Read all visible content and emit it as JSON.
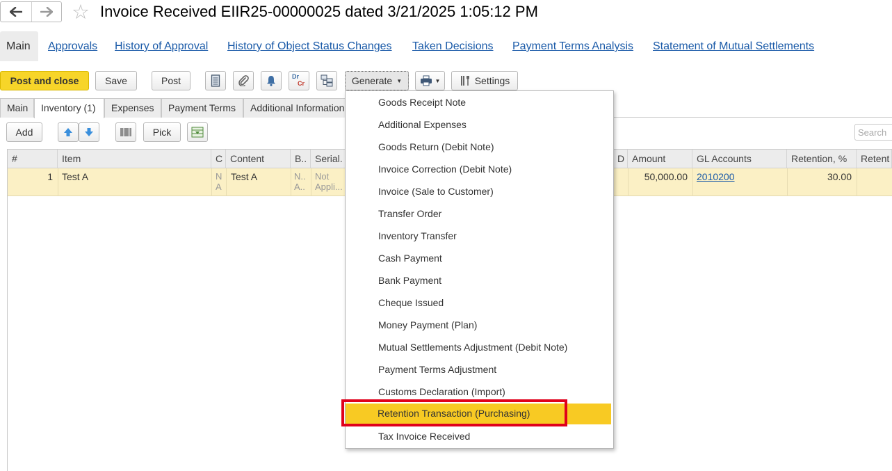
{
  "window": {
    "title": "Invoice Received EIIR25-00000025 dated 3/21/2025 1:05:12 PM",
    "back_icon": "arrow-left-icon",
    "forward_icon": "arrow-right-icon",
    "favorite_icon": "star-icon"
  },
  "sections": {
    "main": "Main",
    "links": [
      "Approvals",
      "History of Approval",
      "History of Object Status Changes",
      "Taken Decisions",
      "Payment Terms Analysis",
      "Statement of Mutual Settlements"
    ]
  },
  "toolbar": {
    "post_close": "Post and close",
    "save": "Save",
    "post": "Post",
    "generate": "Generate",
    "settings": "Settings",
    "drcr_top": "Dr",
    "drcr_bottom": "Cr",
    "accent": "#f7d529"
  },
  "tabs": [
    "Main",
    "Inventory (1)",
    "Expenses",
    "Payment Terms",
    "Additional Information"
  ],
  "table_toolbar": {
    "add": "Add",
    "pick": "Pick",
    "search_placeholder": "Search"
  },
  "grid": {
    "columns": [
      "#",
      "Item",
      "C",
      "Content",
      "B..",
      "Serial.",
      "D",
      "Amount",
      "GL Accounts",
      "Retention, %",
      "Retent"
    ],
    "row": {
      "num": "1",
      "item": "Test A",
      "c_line1": "N",
      "c_line2": "A",
      "content": "Test A",
      "b_line1": "N..",
      "b_line2": "A..",
      "serial_line1": "Not",
      "serial_line2": "Appli...",
      "amount": "50,000.00",
      "gl_account": "2010200",
      "retention": "30.00"
    }
  },
  "generate_menu": {
    "items": [
      "Goods Receipt Note",
      "Additional Expenses",
      "Goods Return (Debit Note)",
      "Invoice Correction (Debit Note)",
      "Invoice (Sale to Customer)",
      "Transfer Order",
      "Inventory Transfer",
      "Cash Payment",
      "Bank Payment",
      "Cheque Issued",
      "Money Payment (Plan)",
      "Mutual Settlements Adjustment (Debit Note)",
      "Payment Terms Adjustment",
      "Customs Declaration (Import)",
      "Retention Transaction (Purchasing)",
      "Tax Invoice Received"
    ],
    "highlighted_index": 14,
    "highlight_color": "#f8ca23",
    "annotation_color": "#e0001b"
  }
}
